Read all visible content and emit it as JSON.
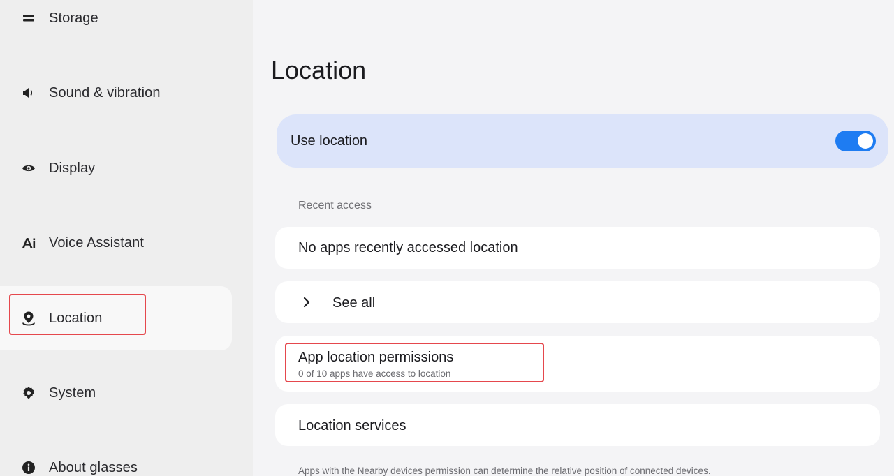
{
  "sidebar": {
    "items": [
      {
        "label": "Storage",
        "icon": "storage-icon"
      },
      {
        "label": "Sound & vibration",
        "icon": "speaker-icon"
      },
      {
        "label": "Display",
        "icon": "eye-icon"
      },
      {
        "label": "Voice Assistant",
        "icon": "ai-icon"
      },
      {
        "label": "Location",
        "icon": "location-pin-icon",
        "active": true
      },
      {
        "label": "System",
        "icon": "gear-icon"
      },
      {
        "label": "About glasses",
        "icon": "info-icon"
      }
    ]
  },
  "main": {
    "title": "Location",
    "use_location": {
      "label": "Use location",
      "enabled": true
    },
    "recent_access": {
      "header": "Recent access",
      "empty_text": "No apps recently accessed location",
      "see_all": "See all"
    },
    "app_permissions": {
      "title": "App location permissions",
      "subtitle": "0 of 10 apps have access to location"
    },
    "location_services": {
      "label": "Location services"
    },
    "footer_note": "Apps with the Nearby devices permission can determine the relative position of connected devices."
  },
  "colors": {
    "accent": "#1e7cf2",
    "highlight_box": "#e5484d",
    "use_location_bg": "#dce4fa"
  }
}
